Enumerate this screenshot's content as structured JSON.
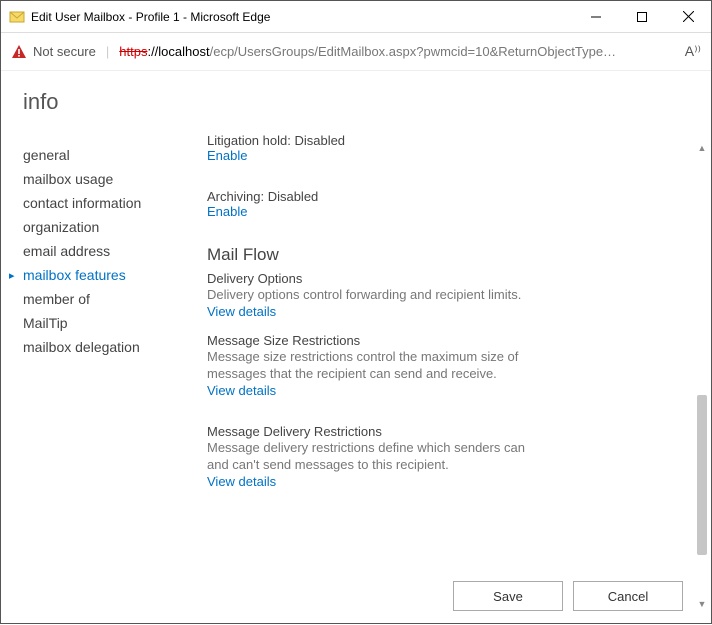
{
  "window": {
    "title": "Edit User Mailbox - Profile 1 - Microsoft Edge"
  },
  "addressbar": {
    "not_secure": "Not secure",
    "url_scheme": "https",
    "url_host": "://localhost",
    "url_path": "/ecp/UsersGroups/EditMailbox.aspx?pwmcid=10&ReturnObjectType…",
    "reader_glyph": "A⁾⁾"
  },
  "page": {
    "heading": "info",
    "nav": [
      "general",
      "mailbox usage",
      "contact information",
      "organization",
      "email address",
      "mailbox features",
      "member of",
      "MailTip",
      "mailbox delegation"
    ],
    "active_index": 5
  },
  "details": {
    "litigation": {
      "label": "Litigation hold: Disabled",
      "action": "Enable"
    },
    "archiving": {
      "label": "Archiving: Disabled",
      "action": "Enable"
    },
    "mailflow": {
      "title": "Mail Flow",
      "delivery": {
        "head": "Delivery Options",
        "desc": "Delivery options control forwarding and recipient limits.",
        "link": "View details"
      },
      "size": {
        "head": "Message Size Restrictions",
        "desc": "Message size restrictions control the maximum size of messages that the recipient can send and receive.",
        "link": "View details"
      },
      "msgdel": {
        "head": "Message Delivery Restrictions",
        "desc": "Message delivery restrictions define which senders can and can't send messages to this recipient.",
        "link": "View details"
      }
    }
  },
  "footer": {
    "save": "Save",
    "cancel": "Cancel"
  }
}
